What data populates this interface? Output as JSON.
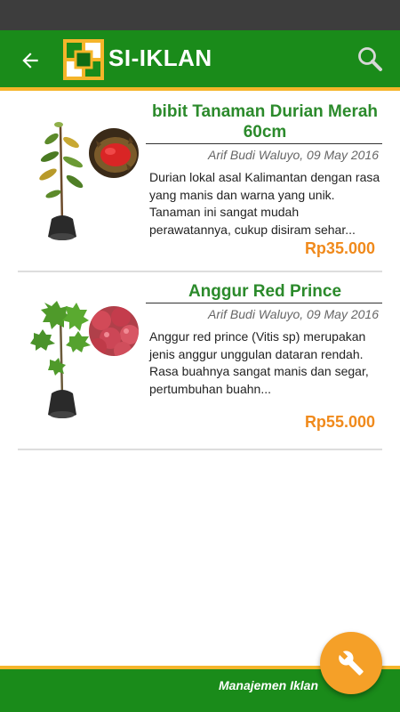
{
  "app": {
    "title": "SI-IKLAN",
    "colors": {
      "primary": "#1a8b1a",
      "accent": "#f5b52a",
      "price": "#f08a1c",
      "fab": "#f5a028"
    },
    "icons": {
      "back": "arrow-left-icon",
      "search": "search-icon",
      "logo": "si-iklan-logo",
      "fab": "wrench-icon"
    }
  },
  "listings": [
    {
      "title": "bibit Tanaman Durian Merah 60cm",
      "author_date": "Arif Budi Waluyo, 09 May 2016",
      "description": "Durian lokal asal Kalimantan dengan rasa yang manis dan warna yang unik. Tanaman ini sangat mudah perawatannya, cukup disiram sehar...",
      "price": "Rp35.000"
    },
    {
      "title": "Anggur Red Prince",
      "author_date": "Arif Budi Waluyo, 09 May 2016",
      "description": "Anggur red prince (Vitis sp) merupakan jenis anggur unggulan dataran rendah. Rasa buahnya sangat manis dan segar, pertumbuhan buahn...",
      "price": "Rp55.000"
    }
  ],
  "bottom_bar": {
    "label": "Manajemen Iklan"
  }
}
